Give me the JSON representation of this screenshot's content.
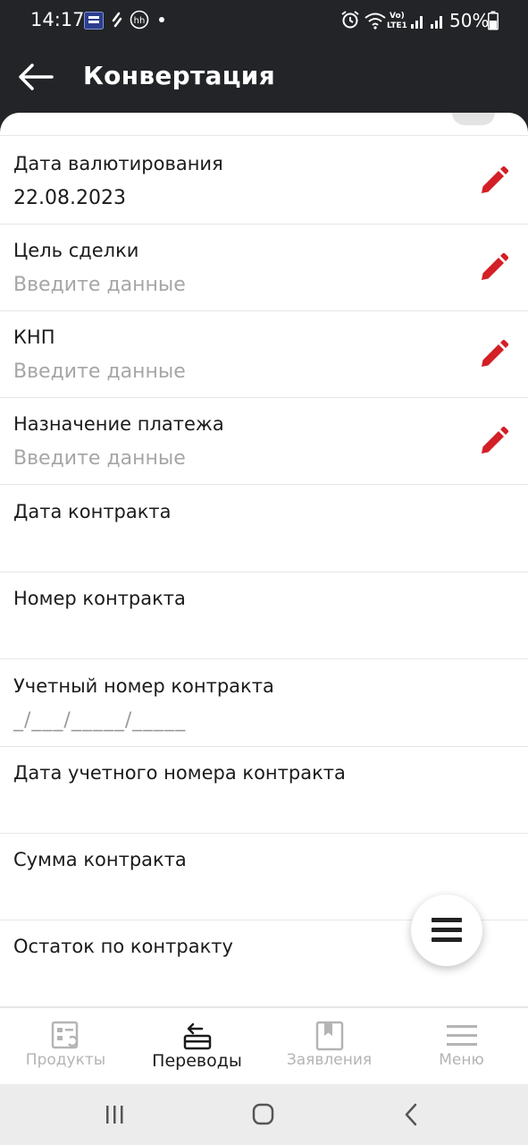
{
  "status_bar": {
    "time": "14:17",
    "battery_percent": "50%",
    "lte_label": "LTE1",
    "volte_label": "Vo)",
    "hh_label": "hh",
    "icons": [
      "app-notification-icon",
      "link-icon",
      "hh-icon",
      "dot-icon",
      "alarm-icon",
      "wifi-icon",
      "volte-icon",
      "signal-icon",
      "battery-icon"
    ]
  },
  "app_bar": {
    "title": "Конвертация",
    "back_icon": "arrow-left-icon"
  },
  "form": {
    "fields": [
      {
        "label": "Дата валютирования",
        "value": "22.08.2023",
        "placeholder": "",
        "editable": true
      },
      {
        "label": "Цель сделки",
        "value": "",
        "placeholder": "Введите данные",
        "editable": true
      },
      {
        "label": "КНП",
        "value": "",
        "placeholder": "Введите данные",
        "editable": true
      },
      {
        "label": "Назначение платежа",
        "value": "",
        "placeholder": "Введите данные",
        "editable": true
      },
      {
        "label": "Дата контракта",
        "value": "",
        "placeholder": "",
        "editable": false
      },
      {
        "label": "Номер контракта",
        "value": "",
        "placeholder": "",
        "editable": false
      },
      {
        "label": "Учетный номер контракта",
        "value": "_/___/_____/_____",
        "placeholder": "",
        "editable": false
      },
      {
        "label": "Дата учетного номера контракта",
        "value": "",
        "placeholder": "",
        "editable": false
      },
      {
        "label": "Сумма контракта",
        "value": "",
        "placeholder": "",
        "editable": false
      },
      {
        "label": "Остаток по контракту",
        "value": "",
        "placeholder": "",
        "editable": false
      }
    ],
    "edit_icon": "pencil-icon",
    "accent_color": "#d31f26"
  },
  "fab": {
    "icon": "menu-icon"
  },
  "bottom_nav": {
    "items": [
      {
        "label": "Продукты",
        "icon": "products-icon",
        "active": false
      },
      {
        "label": "Переводы",
        "icon": "transfers-icon",
        "active": true
      },
      {
        "label": "Заявления",
        "icon": "applications-icon",
        "active": false
      },
      {
        "label": "Меню",
        "icon": "menu-icon",
        "active": false
      }
    ]
  },
  "system_nav": {
    "buttons": [
      "recent-apps-icon",
      "home-icon",
      "back-icon"
    ]
  },
  "colors": {
    "header_bg": "#222427",
    "accent": "#d31f26",
    "placeholder": "#a6a6a6",
    "nav_inactive": "#b4b4b4"
  }
}
